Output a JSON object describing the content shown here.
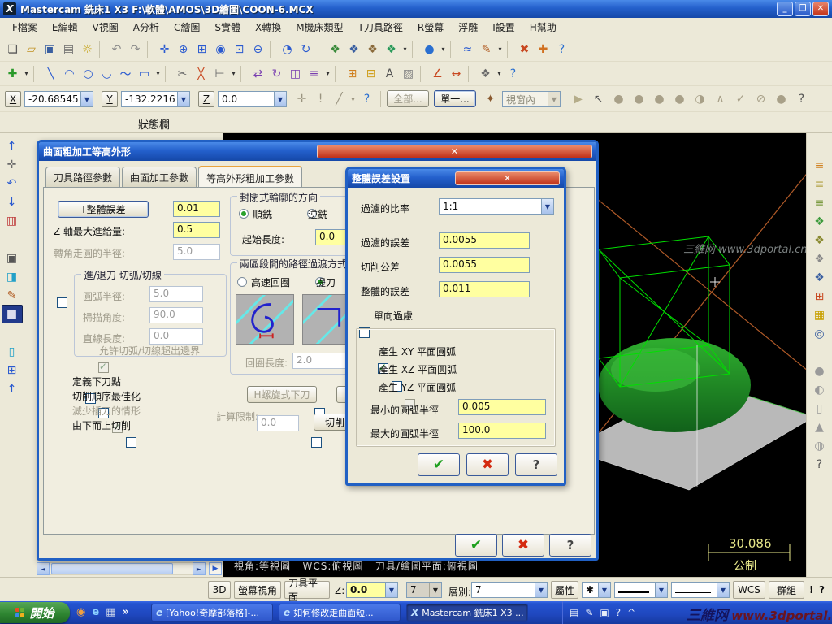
{
  "window": {
    "title": "Mastercam 銑床1 X3   F:\\軟體\\AMOS\\3D繪圖\\COON-6.MCX",
    "logo": "X",
    "min": "_",
    "restore": "❐",
    "close": "✕"
  },
  "menu_items": [
    "F檔案",
    "E編輯",
    "V視圖",
    "A分析",
    "C繪圖",
    "S實體",
    "X轉換",
    "M機床類型",
    "T刀具路徑",
    "R螢幕",
    "浮雕",
    "I設置",
    "H幫助"
  ],
  "toolbar1": [
    {
      "n": "new-file-icon",
      "g": "❏",
      "c": "#5a5a5a"
    },
    {
      "n": "open-file-icon",
      "g": "▱",
      "c": "#c09020"
    },
    {
      "n": "save-icon",
      "g": "▣",
      "c": "#3a5fa0"
    },
    {
      "n": "print-icon",
      "g": "▤",
      "c": "#6a6a6a"
    },
    {
      "n": "screenshot-icon",
      "g": "☼",
      "c": "#c09a00"
    },
    {
      "n": "separator",
      "g": "",
      "cls": "sep"
    },
    {
      "n": "undo-icon",
      "g": "↶",
      "c": "#8a8a8a"
    },
    {
      "n": "redo-icon",
      "g": "↷",
      "c": "#8a8a8a"
    },
    {
      "n": "separator",
      "g": "",
      "cls": "sep"
    },
    {
      "n": "pan-icon",
      "g": "✛",
      "c": "#2a5ad0"
    },
    {
      "n": "zoom-in-icon",
      "g": "⊕",
      "c": "#2a5ad0"
    },
    {
      "n": "zoom-window-icon",
      "g": "⊞",
      "c": "#2a5ad0"
    },
    {
      "n": "zoom-target-icon",
      "g": "◉",
      "c": "#2a5ad0"
    },
    {
      "n": "zoom-fit-icon",
      "g": "⊡",
      "c": "#2a5ad0"
    },
    {
      "n": "zoom-out-icon",
      "g": "⊖",
      "c": "#2a5ad0"
    },
    {
      "n": "separator",
      "g": "",
      "cls": "sep"
    },
    {
      "n": "zoom-percent-icon",
      "g": "◔",
      "c": "#2a5ad0"
    },
    {
      "n": "dynamic-rotate-icon",
      "g": "↻",
      "c": "#2a5ad0"
    },
    {
      "n": "separator",
      "g": "",
      "cls": "sep"
    },
    {
      "n": "top-view-icon",
      "g": "❖",
      "c": "#3a8a3a"
    },
    {
      "n": "front-view-icon",
      "g": "❖",
      "c": "#3a5fa0"
    },
    {
      "n": "side-view-icon",
      "g": "❖",
      "c": "#8a6a3a"
    },
    {
      "n": "iso-view-icon",
      "g": "❖",
      "c": "#2a9a5a"
    },
    {
      "n": "view-menu-caret",
      "g": "▾",
      "c": "#333",
      "cls": "caret"
    },
    {
      "n": "separator",
      "g": "",
      "cls": "sep"
    },
    {
      "n": "shading-icon",
      "g": "●",
      "c": "#2a6fd0"
    },
    {
      "n": "shading-caret",
      "g": "▾",
      "c": "#333",
      "cls": "caret"
    },
    {
      "n": "separator",
      "g": "",
      "cls": "sep"
    },
    {
      "n": "curve-icon",
      "g": "≈",
      "c": "#2a5ad0"
    },
    {
      "n": "surface-edit-icon",
      "g": "✎",
      "c": "#b05a20"
    },
    {
      "n": "draw-caret",
      "g": "▾",
      "c": "#333",
      "cls": "caret"
    },
    {
      "n": "separator",
      "g": "",
      "cls": "sep"
    },
    {
      "n": "delete-icon",
      "g": "✖",
      "c": "#c84820"
    },
    {
      "n": "restore-icon",
      "g": "✚",
      "c": "#d07020"
    },
    {
      "n": "help-icon",
      "g": "?",
      "c": "#2a6fd0"
    }
  ],
  "toolbar2": [
    {
      "n": "create-point-icon",
      "g": "✚",
      "c": "#2a9a2a"
    },
    {
      "n": "point-caret",
      "g": "▾",
      "c": "#333",
      "cls": "caret"
    },
    {
      "n": "separator",
      "g": "",
      "cls": "sep"
    },
    {
      "n": "line-icon",
      "g": "╲",
      "c": "#2a5ad0"
    },
    {
      "n": "arc-icon",
      "g": "◠",
      "c": "#2a5ad0"
    },
    {
      "n": "circle-icon",
      "g": "○",
      "c": "#2a5ad0"
    },
    {
      "n": "fillet-icon",
      "g": "◡",
      "c": "#2a5ad0"
    },
    {
      "n": "spline-icon",
      "g": "～",
      "c": "#2a5ad0"
    },
    {
      "n": "rect-icon",
      "g": "▭",
      "c": "#2a5ad0"
    },
    {
      "n": "draw-more-caret",
      "g": "▾",
      "c": "#333",
      "cls": "caret"
    },
    {
      "n": "separator",
      "g": "",
      "cls": "sep"
    },
    {
      "n": "trim-icon",
      "g": "✂",
      "c": "#6a6a6a"
    },
    {
      "n": "break-icon",
      "g": "╳",
      "c": "#c84820"
    },
    {
      "n": "extend-icon",
      "g": "⊢",
      "c": "#6a6a6a"
    },
    {
      "n": "modify-caret",
      "g": "▾",
      "c": "#333",
      "cls": "caret"
    },
    {
      "n": "separator",
      "g": "",
      "cls": "sep"
    },
    {
      "n": "translate-icon",
      "g": "⇄",
      "c": "#7a3fb0"
    },
    {
      "n": "rotate-icon",
      "g": "↻",
      "c": "#7a3fb0"
    },
    {
      "n": "mirror-icon",
      "g": "◫",
      "c": "#7a3fb0"
    },
    {
      "n": "offset-icon",
      "g": "≡",
      "c": "#7a3fb0"
    },
    {
      "n": "xform-caret",
      "g": "▾",
      "c": "#333",
      "cls": "caret"
    },
    {
      "n": "separator",
      "g": "",
      "cls": "sep"
    },
    {
      "n": "grid-icon",
      "g": "⊞",
      "c": "#d08020"
    },
    {
      "n": "grid-alt-icon",
      "g": "⊟",
      "c": "#d0a020"
    },
    {
      "n": "note-icon",
      "g": "A",
      "c": "#555"
    },
    {
      "n": "hatch-icon",
      "g": "▨",
      "c": "#888"
    },
    {
      "n": "separator",
      "g": "",
      "cls": "sep"
    },
    {
      "n": "analyze-angle-icon",
      "g": "∠",
      "c": "#c84820"
    },
    {
      "n": "measure-icon",
      "g": "↔",
      "c": "#c84820"
    },
    {
      "n": "separator",
      "g": "",
      "cls": "sep"
    },
    {
      "n": "cplane-icon",
      "g": "❖",
      "c": "#6a6a6a"
    },
    {
      "n": "cplane-caret",
      "g": "▾",
      "c": "#333",
      "cls": "caret"
    },
    {
      "n": "help2-icon",
      "g": "?",
      "c": "#2a6fd0"
    }
  ],
  "coord": {
    "x_label": "X",
    "x_value": "-20.68545",
    "y_label": "Y",
    "y_value": "-132.2216",
    "z_label": "Z",
    "z_value": "0.0",
    "mid_icons": [
      {
        "n": "autocursor-icon",
        "g": "✛",
        "c": "#9a9480"
      },
      {
        "n": "fastpoint-icon",
        "g": "!",
        "c": "#9a9480"
      },
      {
        "n": "sketch-icon",
        "g": "╱",
        "c": "#9a9480"
      },
      {
        "n": "cursor-caret",
        "g": "▾",
        "c": "#9a9480",
        "cls": "caret"
      },
      {
        "n": "coord-help-icon",
        "g": "?",
        "c": "#2a6fd0"
      }
    ],
    "all_button": "全部...",
    "single_button": "單一...",
    "window_select": "視窗內",
    "tail_icons": [
      {
        "n": "select-mode-icon",
        "g": "▶",
        "c": "#b5ad8a"
      },
      {
        "n": "pointer-icon",
        "g": "↖",
        "c": "#555"
      },
      {
        "n": "mask-solid-icon",
        "g": "●",
        "c": "#a8a088"
      },
      {
        "n": "mask-wire-icon",
        "g": "●",
        "c": "#a8a088"
      },
      {
        "n": "mask-surface-icon",
        "g": "●",
        "c": "#a8a088"
      },
      {
        "n": "mask-drafting-icon",
        "g": "●",
        "c": "#a8a088"
      },
      {
        "n": "mask-sphere-icon",
        "g": "◑",
        "c": "#a8a088"
      },
      {
        "n": "select-last-icon",
        "g": "∧",
        "c": "#a8a088"
      },
      {
        "n": "select-ok-icon",
        "g": "✓",
        "c": "#a8a088"
      },
      {
        "n": "select-cancel-icon",
        "g": "⊘",
        "c": "#a8a088"
      },
      {
        "n": "select-dot-icon",
        "g": "●",
        "c": "#a8a088"
      },
      {
        "n": "select-help-icon",
        "g": "?",
        "c": "#555"
      }
    ]
  },
  "status_label": "狀態欄",
  "left_tools": [
    {
      "n": "collapse-up-icon",
      "g": "↑",
      "c": "#2a5ad0"
    },
    {
      "n": "select-tool-icon",
      "g": "✛",
      "c": "#6a6a6a"
    },
    {
      "n": "undo-op-icon",
      "g": "↶",
      "c": "#2a5ad0"
    },
    {
      "n": "expand-down-icon",
      "g": "↓",
      "c": "#2a5ad0"
    },
    {
      "n": "clipboard-icon",
      "g": "▥",
      "c": "#c04040"
    },
    {
      "n": "gap",
      "g": "",
      "cls": "gap"
    },
    {
      "n": "window-icon",
      "g": "▣",
      "c": "#555"
    },
    {
      "n": "panel-icon",
      "g": "◨",
      "c": "#22a0c8"
    },
    {
      "n": "edit-icon",
      "g": "✎",
      "c": "#b05a20"
    },
    {
      "n": "active-tool-icon",
      "g": "■",
      "c": "#dde",
      "cls": "pressed"
    },
    {
      "n": "gap",
      "g": "",
      "cls": "gap"
    },
    {
      "n": "bin-icon",
      "g": "▯",
      "c": "#22a0c8"
    },
    {
      "n": "levels-icon",
      "g": "⊞",
      "c": "#2a5ad0"
    },
    {
      "n": "raise-icon",
      "g": "↑",
      "c": "#2a5ad0"
    }
  ],
  "right_tools": [
    {
      "n": "hatch-orange-icon",
      "g": "≡",
      "c": "#d08020"
    },
    {
      "n": "hatch-olive-icon",
      "g": "≡",
      "c": "#b0a040"
    },
    {
      "n": "hatch-green-icon",
      "g": "≡",
      "c": "#7a9a40"
    },
    {
      "n": "cube-green-icon",
      "g": "❖",
      "c": "#3a9a3a"
    },
    {
      "n": "cube-olive-icon",
      "g": "❖",
      "c": "#8a8a30"
    },
    {
      "n": "cube-gray-icon",
      "g": "❖",
      "c": "#8a8a8a"
    },
    {
      "n": "cube-blue-icon",
      "g": "❖",
      "c": "#3a5fa0"
    },
    {
      "n": "grid-color-icon",
      "g": "⊞",
      "c": "#c84820"
    },
    {
      "n": "grid-yellow-icon",
      "g": "▦",
      "c": "#c8a000"
    },
    {
      "n": "target-icon",
      "g": "◎",
      "c": "#3a5fa0"
    },
    {
      "n": "gap",
      "g": "",
      "cls": "gap"
    },
    {
      "n": "shade-ball-icon",
      "g": "●",
      "c": "#9a9a9a"
    },
    {
      "n": "half-ball-icon",
      "g": "◐",
      "c": "#9a9a9a"
    },
    {
      "n": "cylinder-icon",
      "g": "▯",
      "c": "#9a9a9a"
    },
    {
      "n": "cone-icon",
      "g": "▲",
      "c": "#9a9a9a"
    },
    {
      "n": "sphere-icon",
      "g": "◍",
      "c": "#9a9a9a"
    },
    {
      "n": "view-help-icon",
      "g": "?",
      "c": "#555"
    }
  ],
  "viewport": {
    "status_text": "視角:等視圖   WCS:俯視圖   刀具/繪圖平面:俯視圖",
    "scale_value": "30.086",
    "scale_unit": "公制",
    "watermark": "三維网 www.3dportal.cn"
  },
  "dialog": {
    "title": "曲面粗加工等高外形",
    "close": "✕",
    "tabs": [
      {
        "label": "刀具路徑參數",
        "n": "tab-toolpath-params"
      },
      {
        "label": "曲面加工參數",
        "n": "tab-surface-params"
      },
      {
        "label": "等高外形粗加工參數",
        "n": "tab-contour-rough-params",
        "cls": "active"
      }
    ],
    "total_tol_button": "T整體誤差",
    "total_tol_value": "0.01",
    "z_step_label": "Z 軸最大進給量:",
    "z_step_value": "0.5",
    "corner_label": "轉角走圓的半徑:",
    "corner_value": "5.0",
    "entry_group": {
      "title": "進/退刀 切弧/切線",
      "arc_radius_label": "圓弧半徑:",
      "arc_radius_value": "5.0",
      "sweep_label": "掃描角度:",
      "sweep_value": "90.0",
      "line_label": "直線長度:",
      "line_value": "0.0",
      "allow_label": "允許切弧/切線超出邊界"
    },
    "cb_entry_point": "定義下刀點",
    "cb_order": "切削順序最佳化",
    "cb_plunge": "減少插刀的情形",
    "cb_bottom_up": "由下而上切削",
    "direction_group": {
      "title": "封閉式輪廓的方向",
      "climb": "順銑",
      "conventional": "逆銑",
      "start_label": "起始長度:",
      "start_value": "0.0"
    },
    "transition_group": {
      "title": "兩區段間的路徑過渡方式",
      "opt_loop": "高速回圈",
      "opt_retract": "提刀",
      "loop_label": "回圈長度:",
      "loop_value": "2.0"
    },
    "helix_button": "H螺旋式下刀",
    "limit_label": "計算限制:",
    "limit_value": "0.0",
    "cut_button": "切削",
    "ok": "✔",
    "cancel": "✖",
    "help": "?"
  },
  "subdialog": {
    "title": "整體誤差設置",
    "close": "✕",
    "ratio_label": "過濾的比率",
    "ratio_value": "1:1",
    "filter_tol_label": "過濾的誤差",
    "filter_tol_value": "0.0055",
    "cut_tol_label": "切削公差",
    "cut_tol_value": "0.0055",
    "total_tol_label": "整體的誤差",
    "total_tol_value": "0.011",
    "oneway_label": "單向過慮",
    "arc_xy_label": "產生 XY 平面圓弧",
    "arc_xz_label": "產生 XZ 平面圓弧",
    "arc_yz_label": "產生 YZ 平面圓弧",
    "min_r_label": "最小的圓弧半徑",
    "min_r_value": "0.005",
    "max_r_label": "最大的圓弧半徑",
    "max_r_value": "100.0",
    "ok": "✔",
    "cancel": "✖",
    "help": "?"
  },
  "bottombar": {
    "d3": "3D",
    "screen_view": "螢幕視角",
    "tool_plane": "刀具平面",
    "z_label": "Z:",
    "z_value": "0.0",
    "quick_level": "7",
    "quick_caret": "▼",
    "level_label": "層別:",
    "level_value": "7",
    "attr_button": "屬性",
    "point_style": "✱",
    "wcs_button": "WCS",
    "group_button": "群組",
    "excl": "!",
    "help": "?"
  },
  "taskbar": {
    "start": "開始",
    "quick_launch": [
      {
        "n": "media-player-icon",
        "g": "◉",
        "c": "#f0a040"
      },
      {
        "n": "ie-quick-icon",
        "g": "e",
        "c": "#8ad0ff"
      },
      {
        "n": "desktop-icon",
        "g": "▦",
        "c": "#cfd8ea"
      },
      {
        "n": "more-chevron",
        "g": "»",
        "c": "#ffffff"
      }
    ],
    "tasks": [
      {
        "n": "task-yahoo-blog",
        "icon": "e",
        "label": "[Yahoo!奇摩部落格]-..."
      },
      {
        "n": "task-browser-page",
        "icon": "e",
        "label": "如何修改走曲面短..."
      },
      {
        "n": "task-mastercam",
        "icon": "X",
        "label": "Mastercam 銑床1 X3 ...",
        "cls": "active"
      }
    ],
    "tray": [
      {
        "n": "keyboard-icon",
        "g": "▤"
      },
      {
        "n": "pen-icon",
        "g": "✎"
      },
      {
        "n": "ime-icon",
        "g": "▣"
      },
      {
        "n": "tray-help-icon",
        "g": "?"
      },
      {
        "n": "show-hidden-icon",
        "g": "^"
      }
    ],
    "watermark_1": "三維网",
    "watermark_2": "www.3dportal.cn"
  }
}
